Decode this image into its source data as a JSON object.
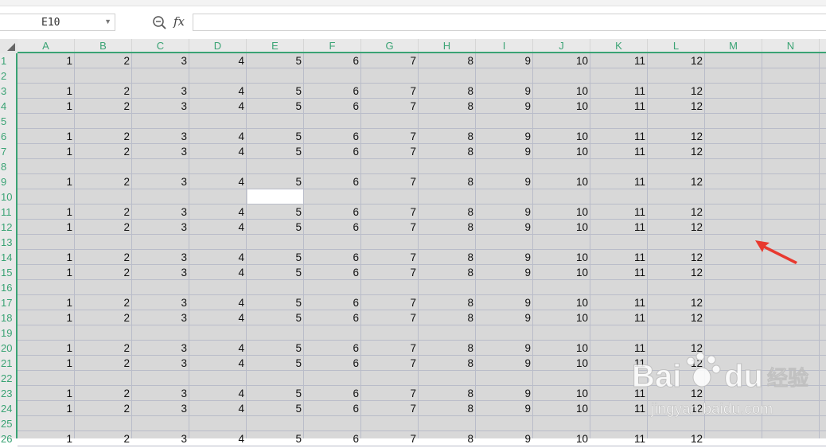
{
  "name_box": {
    "value": "E10"
  },
  "formula_bar": {
    "fx_label": "fx",
    "value": ""
  },
  "columns": [
    "A",
    "B",
    "C",
    "D",
    "E",
    "F",
    "G",
    "H",
    "I",
    "J",
    "K",
    "L",
    "M",
    "N"
  ],
  "rows": [
    "1",
    "2",
    "3",
    "4",
    "5",
    "6",
    "7",
    "8",
    "9",
    "10",
    "11",
    "12",
    "13",
    "14",
    "15",
    "16",
    "17",
    "18",
    "19",
    "20",
    "21",
    "22",
    "23",
    "24",
    "25",
    "26"
  ],
  "row_values": [
    "1",
    "2",
    "3",
    "4",
    "5",
    "6",
    "7",
    "8",
    "9",
    "10",
    "11",
    "12"
  ],
  "filled_rows": [
    1,
    3,
    4,
    6,
    7,
    9,
    11,
    12,
    14,
    15,
    17,
    18,
    20,
    21,
    23,
    24,
    26
  ],
  "selected_cell": "E10",
  "watermark": {
    "brand": "Bai",
    "brand2": "du",
    "cn": "经验",
    "url": "jingyan.baidu.com"
  },
  "colors": {
    "grid_fill": "#d8d8d8",
    "header_text": "#3aa374",
    "arrow": "#e8392f"
  }
}
